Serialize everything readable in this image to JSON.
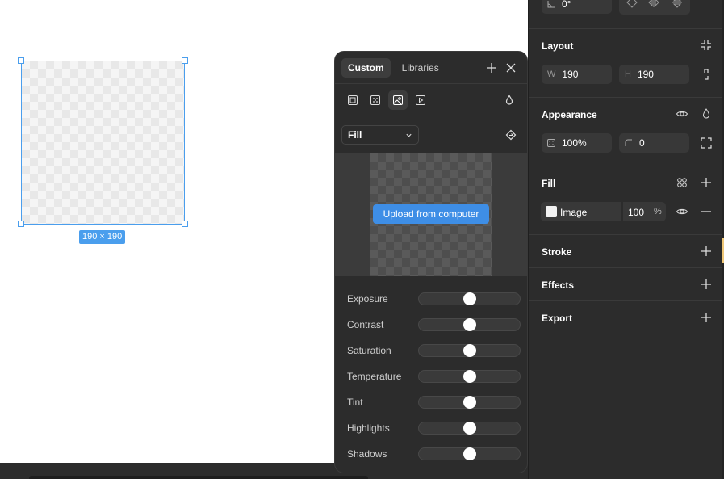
{
  "canvas": {
    "frame_size_label": "190 × 190"
  },
  "popover": {
    "tabs": [
      {
        "label": "Custom",
        "active": true
      },
      {
        "label": "Libraries",
        "active": false
      }
    ],
    "fill_types": [
      "solid-fill-icon",
      "gradient-fill-icon",
      "image-fill-icon",
      "video-fill-icon"
    ],
    "mode_select": "Fill",
    "upload_label": "Upload from computer",
    "adjustments": [
      {
        "label": "Exposure",
        "value": 0
      },
      {
        "label": "Contrast",
        "value": 0
      },
      {
        "label": "Saturation",
        "value": 0
      },
      {
        "label": "Temperature",
        "value": 0
      },
      {
        "label": "Tint",
        "value": 0
      },
      {
        "label": "Highlights",
        "value": 0
      },
      {
        "label": "Shadows",
        "value": 0
      }
    ]
  },
  "panel": {
    "rotation": "0°",
    "layout": {
      "title": "Layout",
      "w_label": "W",
      "w_value": "190",
      "h_label": "H",
      "h_value": "190"
    },
    "appearance": {
      "title": "Appearance",
      "opacity": "100%",
      "radius": "0"
    },
    "fill": {
      "title": "Fill",
      "type_label": "Image",
      "opacity": "100",
      "unit": "%"
    },
    "stroke": {
      "title": "Stroke"
    },
    "effects": {
      "title": "Effects"
    },
    "export": {
      "title": "Export"
    }
  },
  "colors": {
    "accent": "#4a9eed",
    "button": "#3e8ee6",
    "panel_bg": "#2c2c2c"
  }
}
